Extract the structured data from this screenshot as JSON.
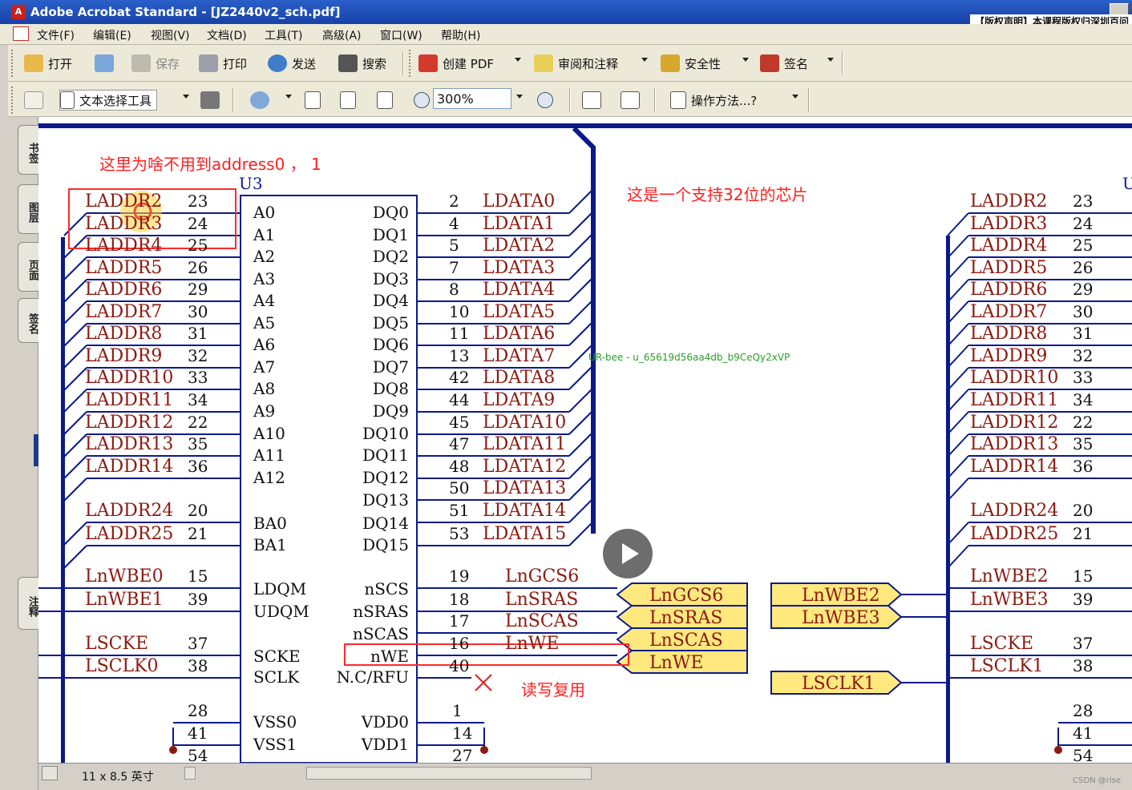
{
  "window": {
    "title": "Adobe Acrobat Standard - [JZ2440v2_sch.pdf]",
    "copyright": "【版权声明】本课程版权归深圳百问"
  },
  "menu": [
    "文件(F)",
    "编辑(E)",
    "视图(V)",
    "文档(D)",
    "工具(T)",
    "高级(A)",
    "窗口(W)",
    "帮助(H)"
  ],
  "toolbar1": {
    "open": "打开",
    "save": "保存",
    "print": "打印",
    "send": "发送",
    "search": "搜索",
    "create_pdf": "创建 PDF",
    "review": "审阅和注释",
    "security": "安全性",
    "sign": "签名"
  },
  "toolbar2": {
    "select_tool": "文本选择工具",
    "zoom": "300%",
    "howto": "操作方法...?"
  },
  "nav_tabs": [
    "书签",
    "图层",
    "页面",
    "签名",
    "注释"
  ],
  "status": {
    "page_size": "11 x 8.5 英寸",
    "csdn": "CSDN @rise"
  },
  "annotations": {
    "question": "这里为啥不用到address0 ， 1",
    "chip32": "这是一个支持32位的芯片",
    "rw_mux": "读写复用",
    "watermark": "UR-bee - u_65619d56aa4db_b9CeQy2xVP"
  },
  "schematic": {
    "u3_label": "U3",
    "u4_label": "U",
    "left_nets": [
      {
        "net": "LADDR2",
        "pin": "23"
      },
      {
        "net": "LADDR3",
        "pin": "24"
      },
      {
        "net": "LADDR4",
        "pin": "25"
      },
      {
        "net": "LADDR5",
        "pin": "26"
      },
      {
        "net": "LADDR6",
        "pin": "29"
      },
      {
        "net": "LADDR7",
        "pin": "30"
      },
      {
        "net": "LADDR8",
        "pin": "31"
      },
      {
        "net": "LADDR9",
        "pin": "32"
      },
      {
        "net": "LADDR10",
        "pin": "33"
      },
      {
        "net": "LADDR11",
        "pin": "34"
      },
      {
        "net": "LADDR12",
        "pin": "22"
      },
      {
        "net": "LADDR13",
        "pin": "35"
      },
      {
        "net": "LADDR14",
        "pin": "36"
      },
      {
        "net": "LADDR24",
        "pin": "20"
      },
      {
        "net": "LADDR25",
        "pin": "21"
      },
      {
        "net": "LnWBE0",
        "pin": "15"
      },
      {
        "net": "LnWBE1",
        "pin": "39"
      },
      {
        "net": "LSCKE",
        "pin": "37"
      },
      {
        "net": "LSCLK0",
        "pin": "38"
      }
    ],
    "right_nets": [
      {
        "net": "LADDR2",
        "pin": "23"
      },
      {
        "net": "LADDR3",
        "pin": "24"
      },
      {
        "net": "LADDR4",
        "pin": "25"
      },
      {
        "net": "LADDR5",
        "pin": "26"
      },
      {
        "net": "LADDR6",
        "pin": "29"
      },
      {
        "net": "LADDR7",
        "pin": "30"
      },
      {
        "net": "LADDR8",
        "pin": "31"
      },
      {
        "net": "LADDR9",
        "pin": "32"
      },
      {
        "net": "LADDR10",
        "pin": "33"
      },
      {
        "net": "LADDR11",
        "pin": "34"
      },
      {
        "net": "LADDR12",
        "pin": "22"
      },
      {
        "net": "LADDR13",
        "pin": "35"
      },
      {
        "net": "LADDR14",
        "pin": "36"
      },
      {
        "net": "LADDR24",
        "pin": "20"
      },
      {
        "net": "LADDR25",
        "pin": "21"
      },
      {
        "net": "LnWBE2",
        "pin": "15"
      },
      {
        "net": "LnWBE3",
        "pin": "39"
      },
      {
        "net": "LSCKE",
        "pin": "37"
      },
      {
        "net": "LSCLK1",
        "pin": "38"
      }
    ],
    "left_pins_inside": [
      "A0",
      "A1",
      "A2",
      "A3",
      "A4",
      "A5",
      "A6",
      "A7",
      "A8",
      "A9",
      "A10",
      "A11",
      "A12",
      "BA0",
      "BA1",
      "LDQM",
      "UDQM",
      "SCKE",
      "SCLK",
      "VSS0",
      "VSS1"
    ],
    "right_pins_inside": [
      "DQ0",
      "DQ1",
      "DQ2",
      "DQ3",
      "DQ4",
      "DQ5",
      "DQ6",
      "DQ7",
      "DQ8",
      "DQ9",
      "DQ10",
      "DQ11",
      "DQ12",
      "DQ13",
      "DQ14",
      "DQ15",
      "nSCS",
      "nSRAS",
      "nSCAS",
      "nWE",
      "N.C/RFU",
      "VDD0",
      "VDD1"
    ],
    "data_nets": [
      {
        "pin": "2",
        "net": "LDATA0"
      },
      {
        "pin": "4",
        "net": "LDATA1"
      },
      {
        "pin": "5",
        "net": "LDATA2"
      },
      {
        "pin": "7",
        "net": "LDATA3"
      },
      {
        "pin": "8",
        "net": "LDATA4"
      },
      {
        "pin": "10",
        "net": "LDATA5"
      },
      {
        "pin": "11",
        "net": "LDATA6"
      },
      {
        "pin": "13",
        "net": "LDATA7"
      },
      {
        "pin": "42",
        "net": "LDATA8"
      },
      {
        "pin": "44",
        "net": "LDATA9"
      },
      {
        "pin": "45",
        "net": "LDATA10"
      },
      {
        "pin": "47",
        "net": "LDATA11"
      },
      {
        "pin": "48",
        "net": "LDATA12"
      },
      {
        "pin": "50",
        "net": "LDATA13"
      },
      {
        "pin": "51",
        "net": "LDATA14"
      },
      {
        "pin": "53",
        "net": "LDATA15"
      }
    ],
    "ctrl_nets": [
      {
        "pin": "19",
        "net": "LnGCS6"
      },
      {
        "pin": "18",
        "net": "LnSRAS"
      },
      {
        "pin": "17",
        "net": "LnSCAS"
      },
      {
        "pin": "16",
        "net": "LnWE"
      },
      {
        "pin": "40",
        "net": ""
      }
    ],
    "ports_mid": [
      "LnGCS6",
      "LnSRAS",
      "LnSCAS",
      "LnWE"
    ],
    "ports_right": [
      "LnWBE2",
      "LnWBE3",
      "LSCLK1"
    ],
    "power_left": [
      "28",
      "41",
      "54"
    ],
    "power_right": [
      "1",
      "14",
      "27"
    ],
    "power_far_right": [
      "28",
      "41",
      "54"
    ]
  }
}
